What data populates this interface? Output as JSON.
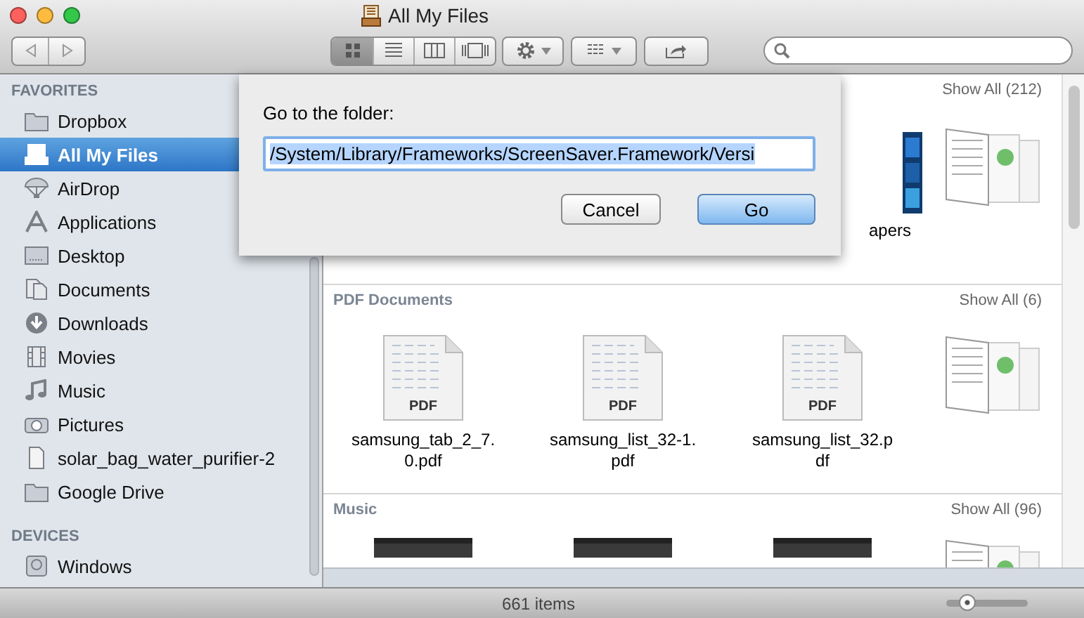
{
  "window": {
    "title": "All My Files"
  },
  "toolbar": {
    "views": [
      {
        "kind": "icons",
        "selected": true
      },
      {
        "kind": "list",
        "selected": false
      },
      {
        "kind": "columns",
        "selected": false
      },
      {
        "kind": "coverflow",
        "selected": false
      }
    ]
  },
  "sidebar": {
    "sections": [
      {
        "title": "FAVORITES",
        "items": [
          {
            "label": "Dropbox",
            "kind": "folder",
            "selected": false
          },
          {
            "label": "All My Files",
            "kind": "files",
            "selected": true
          },
          {
            "label": "AirDrop",
            "kind": "airdrop",
            "selected": false
          },
          {
            "label": "Applications",
            "kind": "apps",
            "selected": false
          },
          {
            "label": "Desktop",
            "kind": "desktop",
            "selected": false
          },
          {
            "label": "Documents",
            "kind": "documents",
            "selected": false
          },
          {
            "label": "Downloads",
            "kind": "download",
            "selected": false
          },
          {
            "label": "Movies",
            "kind": "film",
            "selected": false
          },
          {
            "label": "Music",
            "kind": "music",
            "selected": false
          },
          {
            "label": "Pictures",
            "kind": "camera",
            "selected": false
          },
          {
            "label": "solar_bag_water_purifier-2",
            "kind": "file",
            "selected": false
          },
          {
            "label": "Google Drive",
            "kind": "folder",
            "selected": false
          }
        ]
      },
      {
        "title": "DEVICES",
        "items": [
          {
            "label": "Windows",
            "kind": "disk",
            "selected": false
          }
        ]
      }
    ]
  },
  "content": {
    "sections": [
      {
        "show_all": "Show All (212)",
        "items": [
          {
            "kind": "covered",
            "label": "apers"
          },
          {
            "kind": "stack"
          }
        ]
      },
      {
        "title": "PDF Documents",
        "show_all": "Show All (6)",
        "items": [
          {
            "kind": "pdf",
            "badge": "PDF",
            "label": "samsung_tab_2_7.0.pdf"
          },
          {
            "kind": "pdf",
            "badge": "PDF",
            "label": "samsung_list_32-1.pdf"
          },
          {
            "kind": "pdf",
            "badge": "PDF",
            "label": "samsung_list_32.pdf"
          },
          {
            "kind": "stack"
          }
        ]
      },
      {
        "title": "Music",
        "show_all": "Show All (96)",
        "items": [
          {
            "kind": "album"
          },
          {
            "kind": "album"
          },
          {
            "kind": "album"
          },
          {
            "kind": "stack"
          }
        ]
      }
    ]
  },
  "sheet": {
    "prompt": "Go to the folder:",
    "value": "/System/Library/Frameworks/ScreenSaver.Framework/Versi",
    "buttons": [
      {
        "label": "Cancel",
        "default": false
      },
      {
        "label": "Go",
        "default": true
      }
    ]
  },
  "status_bar": {
    "text": "661 items",
    "zoom": {
      "level": 0.25
    }
  }
}
